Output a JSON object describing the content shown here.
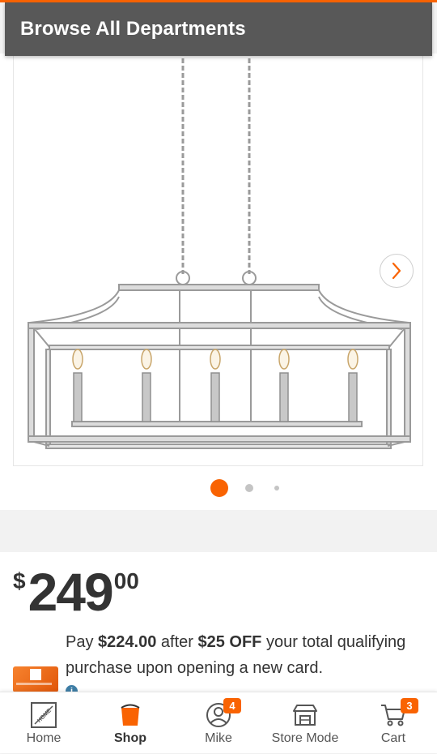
{
  "header": {
    "title": "Browse All Departments"
  },
  "carousel": {
    "total_images": 3,
    "active_index": 0
  },
  "price": {
    "currency": "$",
    "whole": "249",
    "cents": "00"
  },
  "promo": {
    "prefix": "Pay ",
    "discounted_price": "$224.00",
    "middle": " after ",
    "discount": "$25 OFF",
    "suffix": " your total qualifying purchase upon opening a new card."
  },
  "nav": {
    "home": {
      "label": "Home"
    },
    "shop": {
      "label": "Shop"
    },
    "profile": {
      "label": "Mike",
      "badge": "4"
    },
    "store_mode": {
      "label": "Store Mode"
    },
    "cart": {
      "label": "Cart",
      "badge": "3"
    }
  },
  "colors": {
    "brand": "#f96302",
    "header_bg": "#585858",
    "info": "#3e7ea6"
  }
}
